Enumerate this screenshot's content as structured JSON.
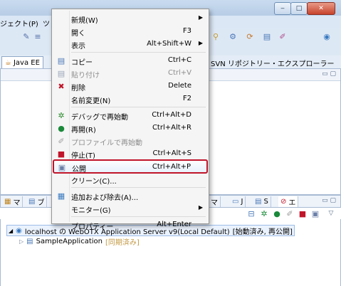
{
  "window": {
    "menubar": [
      "ジェクト(P)",
      "ツ"
    ],
    "min": "‒",
    "max": "□",
    "close": "✕"
  },
  "perspective": {
    "active_tab": "Java EE",
    "explorer_label": "SVN リポジトリー・エクスプローラー"
  },
  "top_view": {
    "controls": "▭ ▢"
  },
  "bottom_view": {
    "tabs": [
      "マ",
      "ブ",
      "マ",
      "J",
      "S",
      "エ"
    ],
    "controls": "▭ ▢",
    "server": {
      "name": "localhost の WebOTX Application Server v9(Local Default)",
      "state": "[始動済み, 再公開]"
    },
    "app": {
      "name": "SampleApplication",
      "state": "[同期済み]"
    }
  },
  "context_menu": {
    "items": [
      {
        "label": "新規(W)",
        "shortcut": "",
        "submenu": true,
        "icon": "",
        "disabled": false
      },
      {
        "label": "開く",
        "shortcut": "F3",
        "submenu": false,
        "icon": "",
        "disabled": false
      },
      {
        "label": "表示",
        "shortcut": "Alt+Shift+W",
        "submenu": true,
        "icon": "",
        "disabled": false
      },
      {
        "sep": true
      },
      {
        "label": "コピー",
        "shortcut": "Ctrl+C",
        "submenu": false,
        "icon": "copy-icon",
        "disabled": false
      },
      {
        "label": "貼り付け",
        "shortcut": "Ctrl+V",
        "submenu": false,
        "icon": "paste-icon",
        "disabled": true
      },
      {
        "label": "削除",
        "shortcut": "Delete",
        "submenu": false,
        "icon": "delete-icon",
        "disabled": false
      },
      {
        "label": "名前変更(N)",
        "shortcut": "F2",
        "submenu": false,
        "icon": "",
        "disabled": false
      },
      {
        "sep": true
      },
      {
        "label": "デバッグで再始動",
        "shortcut": "Ctrl+Alt+D",
        "submenu": false,
        "icon": "debug-icon",
        "disabled": false
      },
      {
        "label": "再開(R)",
        "shortcut": "Ctrl+Alt+R",
        "submenu": false,
        "icon": "run-icon",
        "disabled": false
      },
      {
        "label": "プロファイルで再始動",
        "shortcut": "",
        "submenu": false,
        "icon": "profile-icon",
        "disabled": true
      },
      {
        "label": "停止(T)",
        "shortcut": "Ctrl+Alt+S",
        "submenu": false,
        "icon": "stop-icon",
        "disabled": false
      },
      {
        "label": "公開",
        "shortcut": "Ctrl+Alt+P",
        "submenu": false,
        "icon": "publish-icon",
        "disabled": false,
        "highlight": true
      },
      {
        "label": "クリーン(C)...",
        "shortcut": "",
        "submenu": false,
        "icon": "",
        "disabled": false
      },
      {
        "sep": true
      },
      {
        "label": "追加および除去(A)...",
        "shortcut": "",
        "submenu": false,
        "icon": "add-remove-icon",
        "disabled": false
      },
      {
        "label": "モニター(G)",
        "shortcut": "",
        "submenu": true,
        "icon": "",
        "disabled": false
      },
      {
        "sep": true
      },
      {
        "label": "プロパティー",
        "shortcut": "Alt+Enter",
        "submenu": false,
        "icon": "",
        "disabled": false
      }
    ]
  },
  "colors": {
    "highlight_border": "#c0152a",
    "window_bg": "#d7e4f2"
  }
}
